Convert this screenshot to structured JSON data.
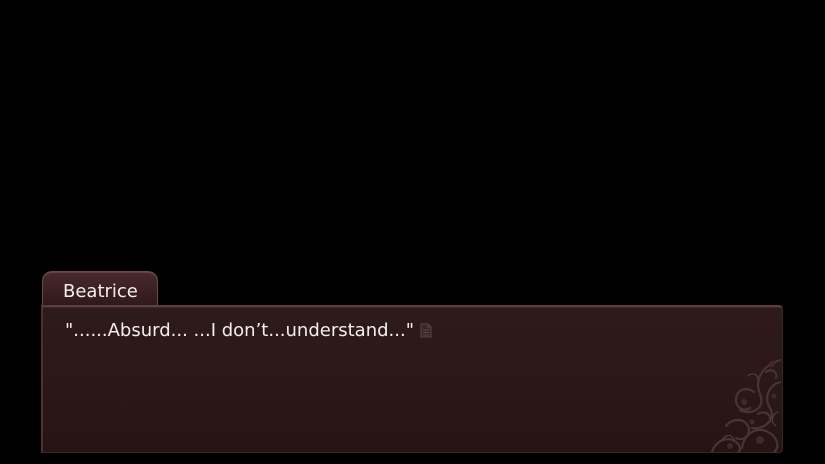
{
  "dialogue": {
    "speaker": "Beatrice",
    "line": "\"......Absurd...  ...I don’t...understand...\""
  },
  "icons": {
    "continue": "page-icon",
    "ornament": "floral-ornament"
  },
  "colors": {
    "background": "#000000",
    "box": "#2a1718",
    "box_border": "#5a3e40",
    "text": "#f4efef"
  }
}
